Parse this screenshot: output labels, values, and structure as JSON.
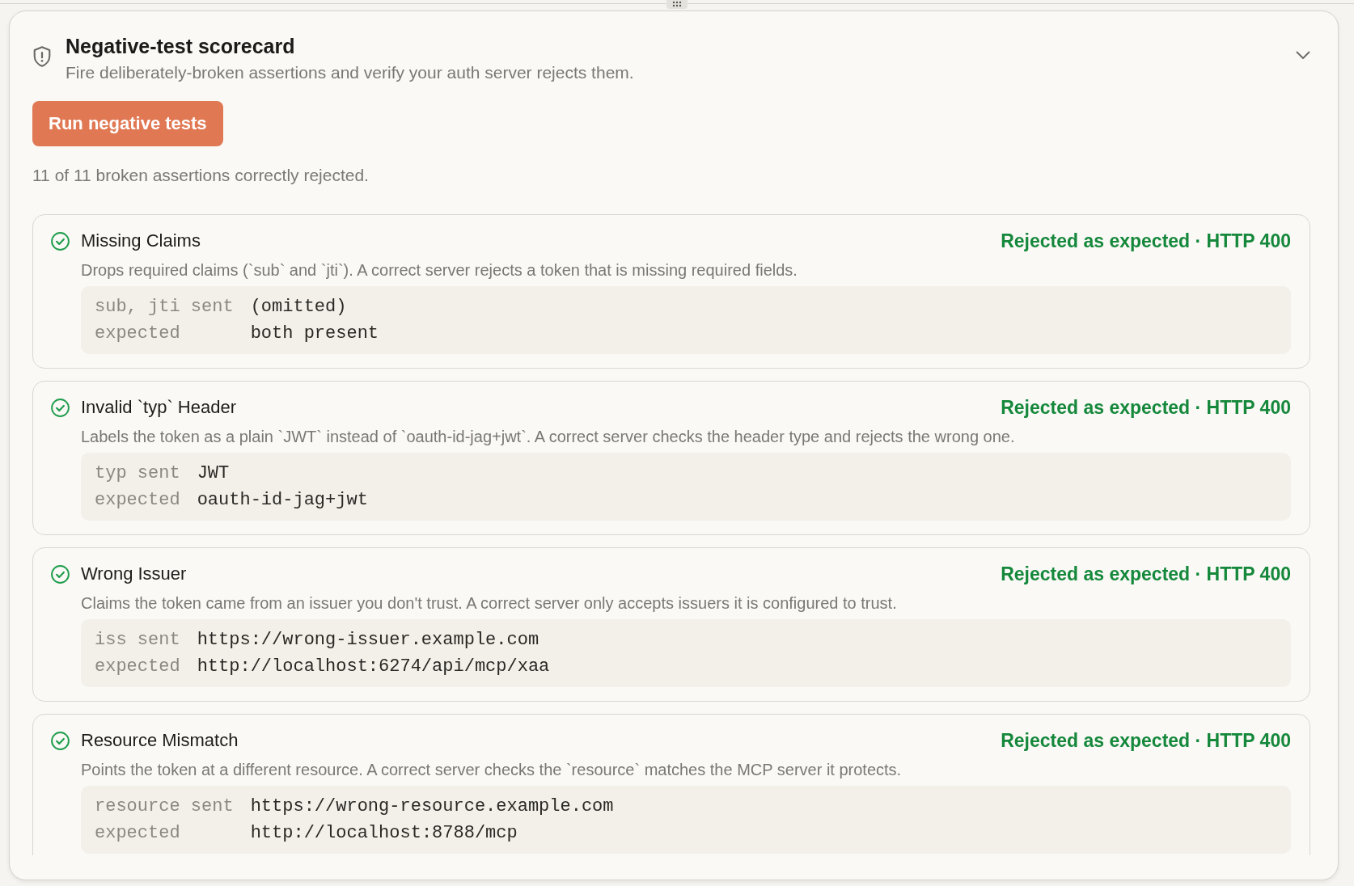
{
  "panel": {
    "title": "Negative-test scorecard",
    "subtitle": "Fire deliberately-broken assertions and verify your auth server rejects them.",
    "run_button": "Run negative tests",
    "summary": "11 of 11 broken assertions correctly rejected.",
    "tests": [
      {
        "title": "Missing Claims",
        "status": "Rejected as expected · HTTP 400",
        "passed": true,
        "description": "Drops required claims (`sub` and `jti`). A correct server rejects a token that is missing required fields.",
        "fields": [
          {
            "key": "sub, jti sent",
            "value": "(omitted)"
          },
          {
            "key": "expected",
            "value": "both present"
          }
        ]
      },
      {
        "title": "Invalid `typ` Header",
        "status": "Rejected as expected · HTTP 400",
        "passed": true,
        "description": "Labels the token as a plain `JWT` instead of `oauth-id-jag+jwt`. A correct server checks the header type and rejects the wrong one.",
        "fields": [
          {
            "key": "typ sent",
            "value": "JWT"
          },
          {
            "key": "expected",
            "value": "oauth-id-jag+jwt"
          }
        ]
      },
      {
        "title": "Wrong Issuer",
        "status": "Rejected as expected · HTTP 400",
        "passed": true,
        "description": "Claims the token came from an issuer you don't trust. A correct server only accepts issuers it is configured to trust.",
        "fields": [
          {
            "key": "iss sent",
            "value": "https://wrong-issuer.example.com"
          },
          {
            "key": "expected",
            "value": "http://localhost:6274/api/mcp/xaa"
          }
        ]
      },
      {
        "title": "Resource Mismatch",
        "status": "Rejected as expected · HTTP 400",
        "passed": true,
        "description": "Points the token at a different resource. A correct server checks the `resource` matches the MCP server it protects.",
        "fields": [
          {
            "key": "resource sent",
            "value": "https://wrong-resource.example.com"
          },
          {
            "key": "expected",
            "value": "http://localhost:8788/mcp"
          }
        ]
      }
    ]
  }
}
